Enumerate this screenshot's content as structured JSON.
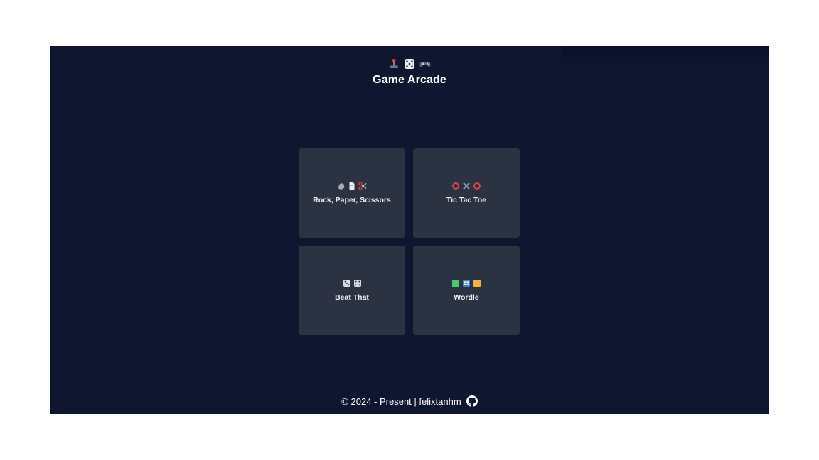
{
  "header": {
    "icons": [
      "joystick-icon",
      "dice-icon",
      "gamepad-icon"
    ],
    "title": "Game Arcade"
  },
  "games": [
    {
      "label": "Rock, Paper, Scissors",
      "icons": [
        "rock-icon",
        "paper-icon",
        "scissors-icon"
      ]
    },
    {
      "label": "Tic Tac Toe",
      "icons": [
        "o-icon",
        "x-icon",
        "o-icon"
      ]
    },
    {
      "label": "Beat That",
      "icons": [
        "dice-icon",
        "dice-icon"
      ]
    },
    {
      "label": "Wordle",
      "icons": [
        "green-square-icon",
        "number-tile-icon",
        "yellow-square-icon"
      ]
    }
  ],
  "footer": {
    "text": "© 2024 - Present | felixtanhm",
    "icon": "github-icon"
  },
  "colors": {
    "background": "#0f1630",
    "card": "#2b3242",
    "tic_red": "#e0414d",
    "tic_x": "#8a93a8",
    "wordle_green": "#4cc96a",
    "wordle_yellow": "#f1b43a"
  }
}
